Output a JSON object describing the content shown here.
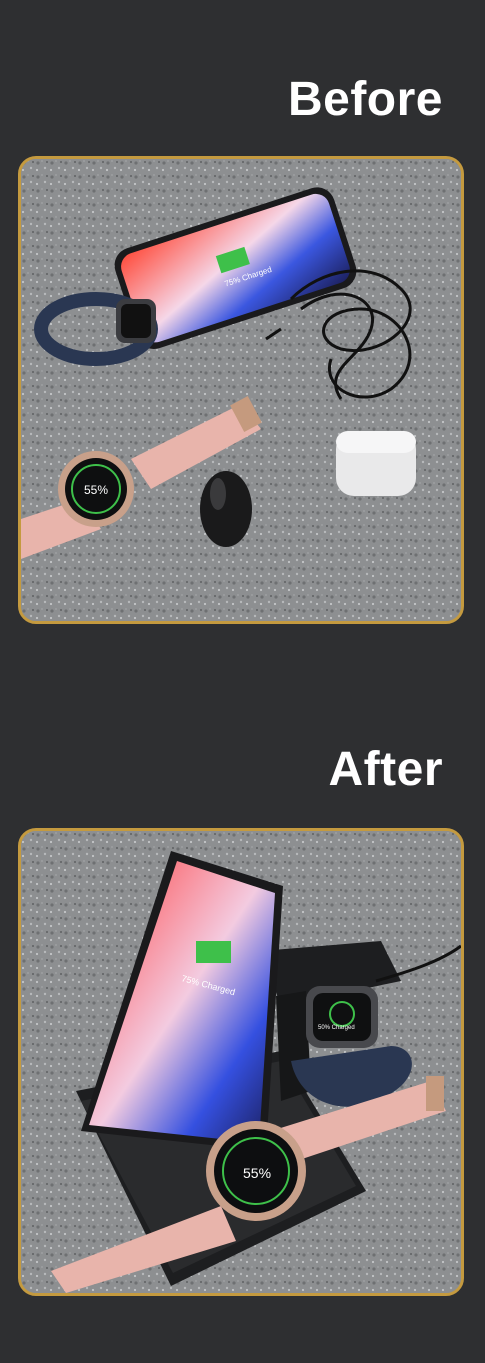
{
  "headings": {
    "before": "Before",
    "after": "After"
  },
  "before_scene": {
    "phone_status": "75% Charged",
    "watch_reading": "55%"
  },
  "after_scene": {
    "phone_status": "75% Charged",
    "small_watch_status": "50% Charged",
    "watch_reading": "55%"
  },
  "colors": {
    "background": "#2e2f31",
    "frame_border": "#c49a3f",
    "heading_text": "#ffffff",
    "granite": "#8a8c8e",
    "pink_strap": "#e8b4ab",
    "navy_strap": "#2a3752",
    "charge_green": "#3ec04a"
  }
}
